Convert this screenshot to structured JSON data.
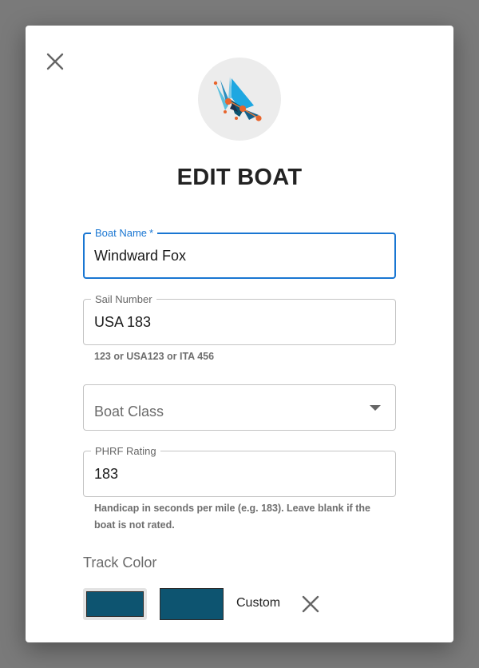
{
  "dialog": {
    "title": "EDIT BOAT",
    "close_icon": "close-icon",
    "logo_icon": "sailboat-logo-icon"
  },
  "form": {
    "boat_name": {
      "label": "Boat Name",
      "required_mark": "*",
      "value": "Windward Fox"
    },
    "sail_number": {
      "label": "Sail Number",
      "value": "USA 183",
      "helper": "123 or USA123 or ITA 456"
    },
    "boat_class": {
      "placeholder": "Boat Class",
      "icon": "dropdown-arrow-icon"
    },
    "phrf_rating": {
      "label": "PHRF Rating",
      "value": "183",
      "helper": "Handicap in seconds per mile (e.g. 183). Leave blank if the boat is not rated."
    },
    "track_color": {
      "label": "Track Color",
      "selected_color": "#0d5470",
      "custom_color": "#0d5470",
      "custom_label": "Custom",
      "clear_icon": "close-icon"
    }
  },
  "colors": {
    "accent": "#1976d2",
    "overlay": "#7a7a7a"
  }
}
